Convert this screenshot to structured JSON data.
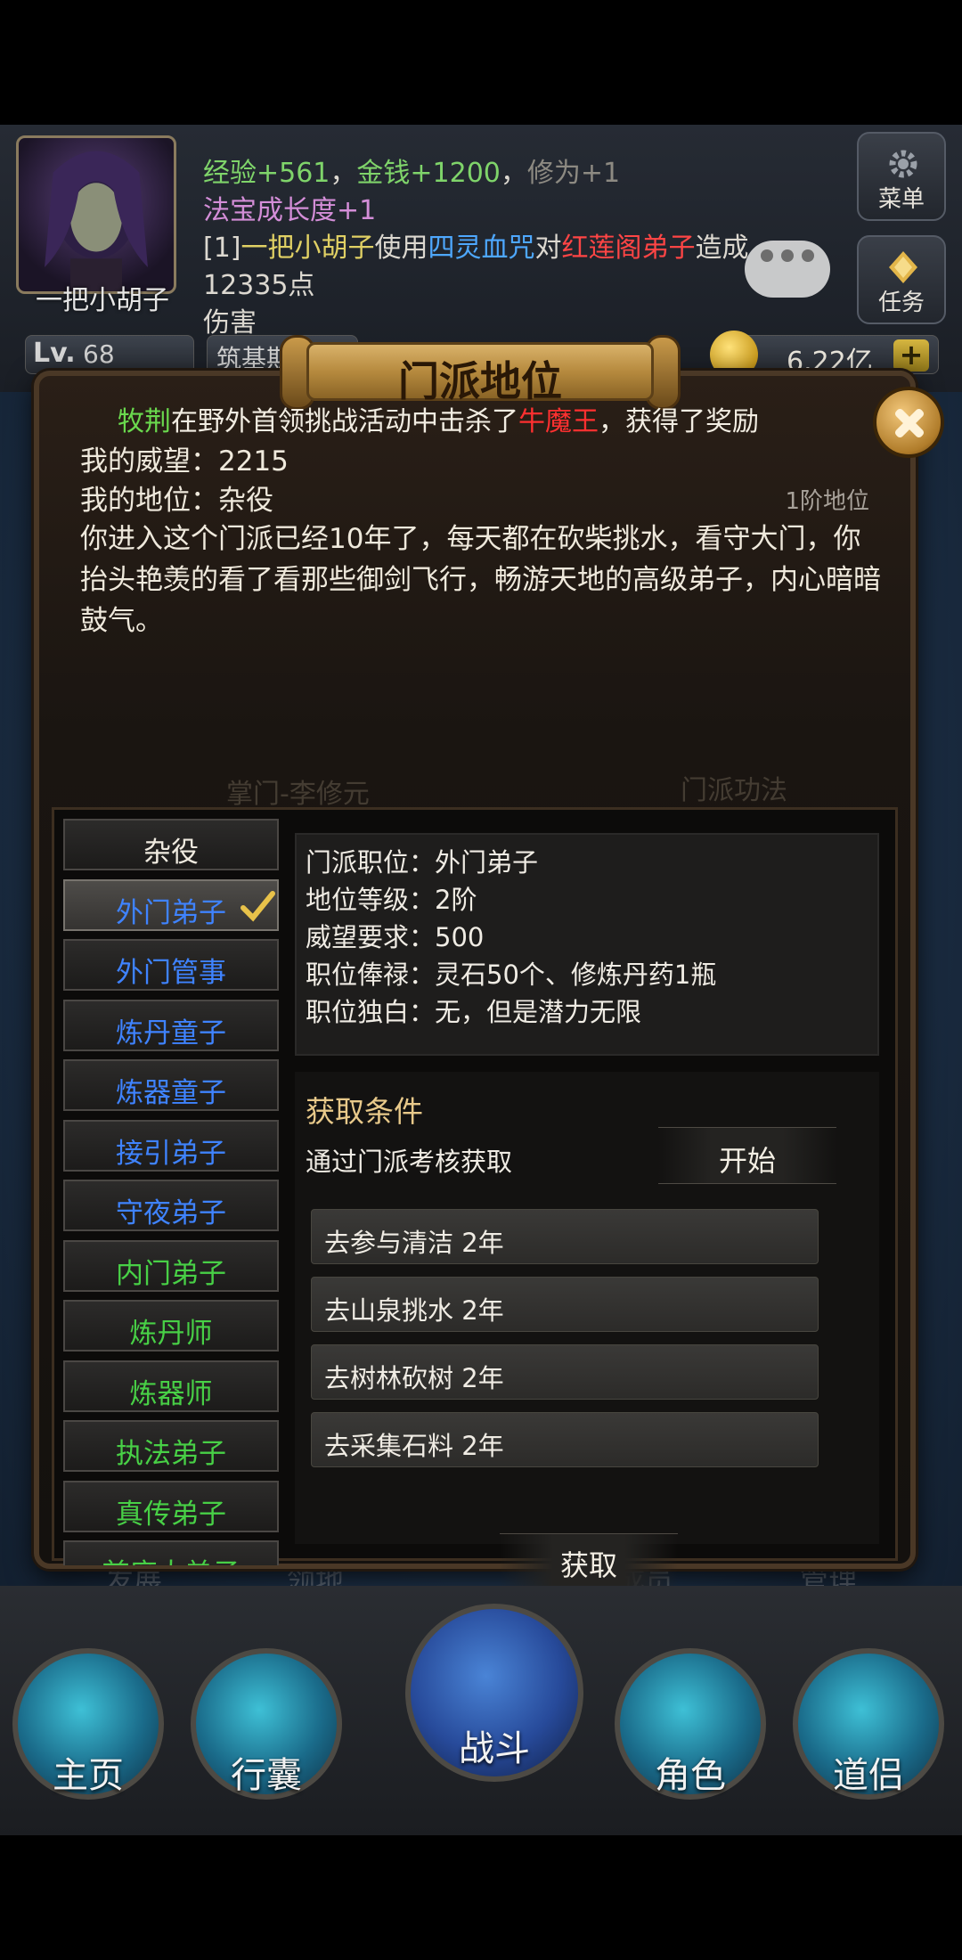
{
  "player": {
    "name": "一把小胡子",
    "level_label": "Lv.",
    "level": "68",
    "realm": "筑基期七阶"
  },
  "log": {
    "line1": {
      "exp_label": "经验",
      "exp": "+561",
      "sep1": "，",
      "gold_label": "金钱",
      "gold": "+1200",
      "sep2": "，",
      "cult_label": "修为",
      "cult": "+1"
    },
    "line2": {
      "label": "法宝成长度",
      "value": "+1"
    },
    "line3": {
      "prefix": "[1]",
      "actor": "一把小胡子",
      "verb": "使用",
      "skill": "四灵血咒",
      "to": "对",
      "target": "红莲阁弟子",
      "tail": "造成12335点"
    },
    "line4": "伤害"
  },
  "side_buttons": {
    "menu": "菜单",
    "task": "任务"
  },
  "currency": {
    "gold": "6.22亿",
    "plus": "+"
  },
  "background_hints": {
    "b1": "发展",
    "b2": "领地",
    "b3": "成员",
    "b4": "管理"
  },
  "dialog": {
    "title": "门派地位",
    "announce": {
      "name": "牧荆",
      "mid": "在野外首领挑战活动中击杀了",
      "boss": "牛魔王",
      "tail": "，获得了奖励"
    },
    "prestige": "我的威望：2215",
    "status": "我的地位：杂役",
    "rank_tag": "1阶地位",
    "story": "你进入这个门派已经10年了，每天都在砍柴挑水，看守大门，你抬头艳羡的看了看那些御剑飞行，畅游天地的高级弟子，内心暗暗鼓气。",
    "faint_master": "掌门-李修元",
    "faint_skill": "门派功法"
  },
  "ranks": [
    {
      "label": "杂役",
      "color": "white"
    },
    {
      "label": "外门弟子",
      "color": "blue",
      "selected": true
    },
    {
      "label": "外门管事",
      "color": "blue"
    },
    {
      "label": "炼丹童子",
      "color": "blue"
    },
    {
      "label": "炼器童子",
      "color": "blue"
    },
    {
      "label": "接引弟子",
      "color": "blue"
    },
    {
      "label": "守夜弟子",
      "color": "blue"
    },
    {
      "label": "内门弟子",
      "color": "green"
    },
    {
      "label": "炼丹师",
      "color": "green"
    },
    {
      "label": "炼器师",
      "color": "green"
    },
    {
      "label": "执法弟子",
      "color": "green"
    },
    {
      "label": "真传弟子",
      "color": "green"
    },
    {
      "label": "首席大弟子",
      "color": "green"
    }
  ],
  "detail": {
    "position": "门派职位：外门弟子",
    "grade": "地位等级：2阶",
    "requirement": "威望要求：500",
    "salary": "职位俸禄：灵石50个、修炼丹药1瓶",
    "monologue": "职位独白：无，但是潜力无限"
  },
  "conditions": {
    "title": "获取条件",
    "method": "通过门派考核获取",
    "start": "开始",
    "tasks": [
      "去参与清洁 2年",
      "去山泉挑水 2年",
      "去树林砍树 2年",
      "去采集石料 2年"
    ],
    "obtain": "获取"
  },
  "nav": {
    "home": "主页",
    "bag": "行囊",
    "battle": "战斗",
    "role": "角色",
    "partner": "道侣"
  },
  "colors": {
    "blue_rank": "#3f83ff",
    "green_rank": "#48d046",
    "boss_red": "#ff3030"
  }
}
